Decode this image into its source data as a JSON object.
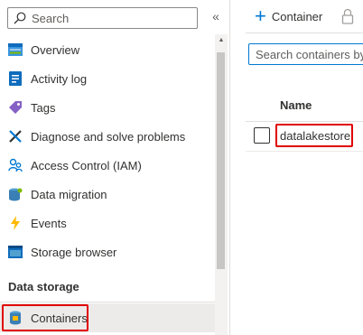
{
  "sidebar": {
    "search_placeholder": "Search",
    "collapse_glyph": "«",
    "items": [
      {
        "label": "Overview",
        "icon": "overview-icon"
      },
      {
        "label": "Activity log",
        "icon": "activity-log-icon"
      },
      {
        "label": "Tags",
        "icon": "tag-icon"
      },
      {
        "label": "Diagnose and solve problems",
        "icon": "wrench-icon"
      },
      {
        "label": "Access Control (IAM)",
        "icon": "people-icon"
      },
      {
        "label": "Data migration",
        "icon": "data-migration-icon"
      },
      {
        "label": "Events",
        "icon": "lightning-icon"
      },
      {
        "label": "Storage browser",
        "icon": "storage-browser-icon"
      }
    ],
    "section_title": "Data storage",
    "selected_item": {
      "label": "Containers",
      "icon": "containers-icon"
    }
  },
  "toolbar": {
    "add_container_label": "Container"
  },
  "main": {
    "search_placeholder": "Search containers by prefix",
    "columns": [
      "Name"
    ],
    "rows": [
      {
        "name": "datalakestore"
      }
    ]
  },
  "colors": {
    "accent": "#0078d4",
    "highlight": "#e00000",
    "selected_bg": "#edebe9"
  }
}
